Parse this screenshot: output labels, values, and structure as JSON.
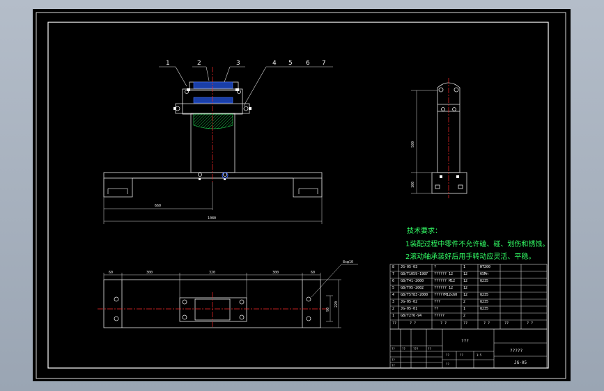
{
  "balloons": [
    "1",
    "2",
    "3",
    "4",
    "5",
    "6",
    "7"
  ],
  "dimensions": {
    "front_left": "660",
    "front_total": "1080",
    "top_d1": "60",
    "top_d2": "300",
    "top_d3": "320",
    "top_d4": "300",
    "top_d5": "60",
    "top_hole": "8xφ10",
    "top_h1": "90",
    "top_h2": "220",
    "side_h1": "500",
    "side_h2": "100"
  },
  "technical_notes": {
    "title": "技术要求：",
    "line1": "1装配过程中零件不允许磕、碰、划伤和锈蚀。",
    "line2": "2滚动轴承装好后用手转动应灵活、平稳。"
  },
  "bom": [
    {
      "no": "8",
      "code": "JG-05-03",
      "name": "?",
      "qty": "1",
      "material": "HT200"
    },
    {
      "no": "7",
      "code": "GB/T1059-1987",
      "name": "?????? 12",
      "qty": "12",
      "material": "65Mn"
    },
    {
      "no": "6",
      "code": "GB/T41-2000",
      "name": "?????? M12",
      "qty": "12",
      "material": "Q235"
    },
    {
      "no": "5",
      "code": "GB/T95-2002",
      "name": "?????? 12",
      "qty": "12",
      "material": ""
    },
    {
      "no": "4",
      "code": "GB/T5783-2000",
      "name": "?????M12x60",
      "qty": "12",
      "material": "Q235"
    },
    {
      "no": "3",
      "code": "JG-05-02",
      "name": "???",
      "qty": "2",
      "material": "Q235"
    },
    {
      "no": "2",
      "code": "JG-05-01",
      "name": "??",
      "qty": "1",
      "material": "Q235"
    },
    {
      "no": "1",
      "code": "GB/T276-94",
      "name": "?????",
      "qty": "2",
      "material": ""
    }
  ],
  "bom_header": {
    "no": "??",
    "code": "? ?",
    "name": "? ?",
    "qty": "??",
    "material": "? ?",
    "mass": "??",
    "remark": "? ?"
  },
  "title_block": {
    "title": "???",
    "company": "?????",
    "drawing_no": "JG-05",
    "small": [
      "??",
      "??",
      "???",
      "??",
      "??",
      "??",
      "??",
      "??",
      "1:5",
      "??"
    ]
  }
}
